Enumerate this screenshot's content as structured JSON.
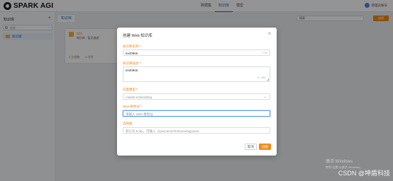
{
  "app": {
    "logo_text": "SPARK AGI"
  },
  "nav": [
    {
      "label": "数据集"
    },
    {
      "label": "知识库"
    },
    {
      "label": "模型"
    }
  ],
  "user": {
    "name": "管理员账号"
  },
  "sidebar": {
    "title": "知识库",
    "add_icon": "+",
    "search_placeholder": "搜索",
    "items": [
      {
        "label": "知识库"
      }
    ]
  },
  "main": {
    "breadcrumb": "知识库",
    "select_value": "搜索",
    "create_button": "创建"
  },
  "card": {
    "name": "知识",
    "desc": "知识库 · 暂无描述",
    "meta_left": "0 文档数",
    "meta_right": "0 字符"
  },
  "modal": {
    "title": "创建 Web 知识库",
    "close_icon": "×",
    "name_label": "知识库名称",
    "name_value": "test0966",
    "name_count": "7 / 64",
    "desc_label": "知识库描述",
    "desc_value": "test0966",
    "desc_count": "8 / 256",
    "model_label": "向量模型",
    "model_value": "maxkb-embedding",
    "url_label": "Web 根地址",
    "url_placeholder": "请输入 Web 根地址",
    "selector_label": "选择器",
    "selector_placeholder": "默认为 body，可输入 .classname/#idname/tagname",
    "cancel_label": "取消",
    "create_label": "创建"
  },
  "watermark": {
    "line1": "激活 Windows",
    "line2": "转到“设置”以激活 Windows。"
  },
  "csdn": "CSDN @坤盾科技"
}
